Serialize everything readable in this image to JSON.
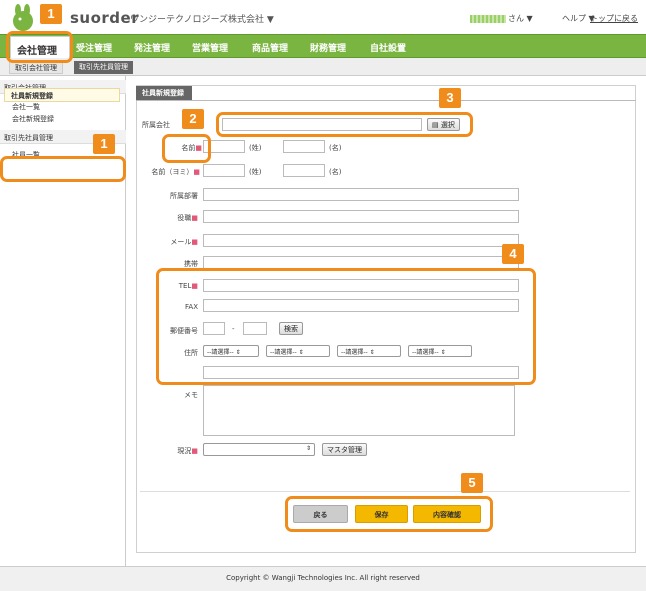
{
  "header": {
    "logo": "suorder",
    "company": "ワンジーテクノロジーズ株式会社 ▼",
    "user_suffix": "さん ▼",
    "help": "ヘルプ ▼",
    "top": "トップに戻る"
  },
  "nav": {
    "active": "会社管理",
    "items": [
      "受注管理",
      "発注管理",
      "営業管理",
      "商品管理",
      "財務管理",
      "自社設置"
    ]
  },
  "subnav": {
    "tabs": [
      "取引会社管理",
      "取引先社員管理"
    ]
  },
  "sidebar": {
    "section1": "取引会社管理",
    "item1": "会社一覧",
    "item2": "会社新規登録",
    "section2": "取引先社員管理",
    "item3": "社員一覧",
    "active": "社員新規登録"
  },
  "main": {
    "tab": "社員新規登録",
    "labels": {
      "affiliation": "所属会社",
      "name": "名前",
      "kana": "名前（ヨミ）",
      "department": "所属部署",
      "position": "役職",
      "mail": "メール",
      "mobile": "携帯",
      "tel": "TEL",
      "fax": "FAX",
      "zip": "郵便番号",
      "address": "住所",
      "memo": "メモ",
      "status": "現況"
    },
    "required_mark": "■",
    "unit_sei": "(姓)",
    "unit_mei": "(名)",
    "zip_dash": "-",
    "select_btn": "選択",
    "search_btn": "検索",
    "select_placeholder": "--請選擇--",
    "master_btn": "マスタ管理"
  },
  "actions": {
    "back": "戻る",
    "save": "保存",
    "confirm": "内容確認"
  },
  "footer": "Copyright © Wangji Technologies Inc. All right reserved",
  "callouts": [
    "1",
    "1",
    "2",
    "3",
    "4",
    "5"
  ],
  "colors": {
    "nav_green": "#7ab441",
    "callout_orange": "#f08c1c",
    "save_yellow": "#f5b800"
  }
}
